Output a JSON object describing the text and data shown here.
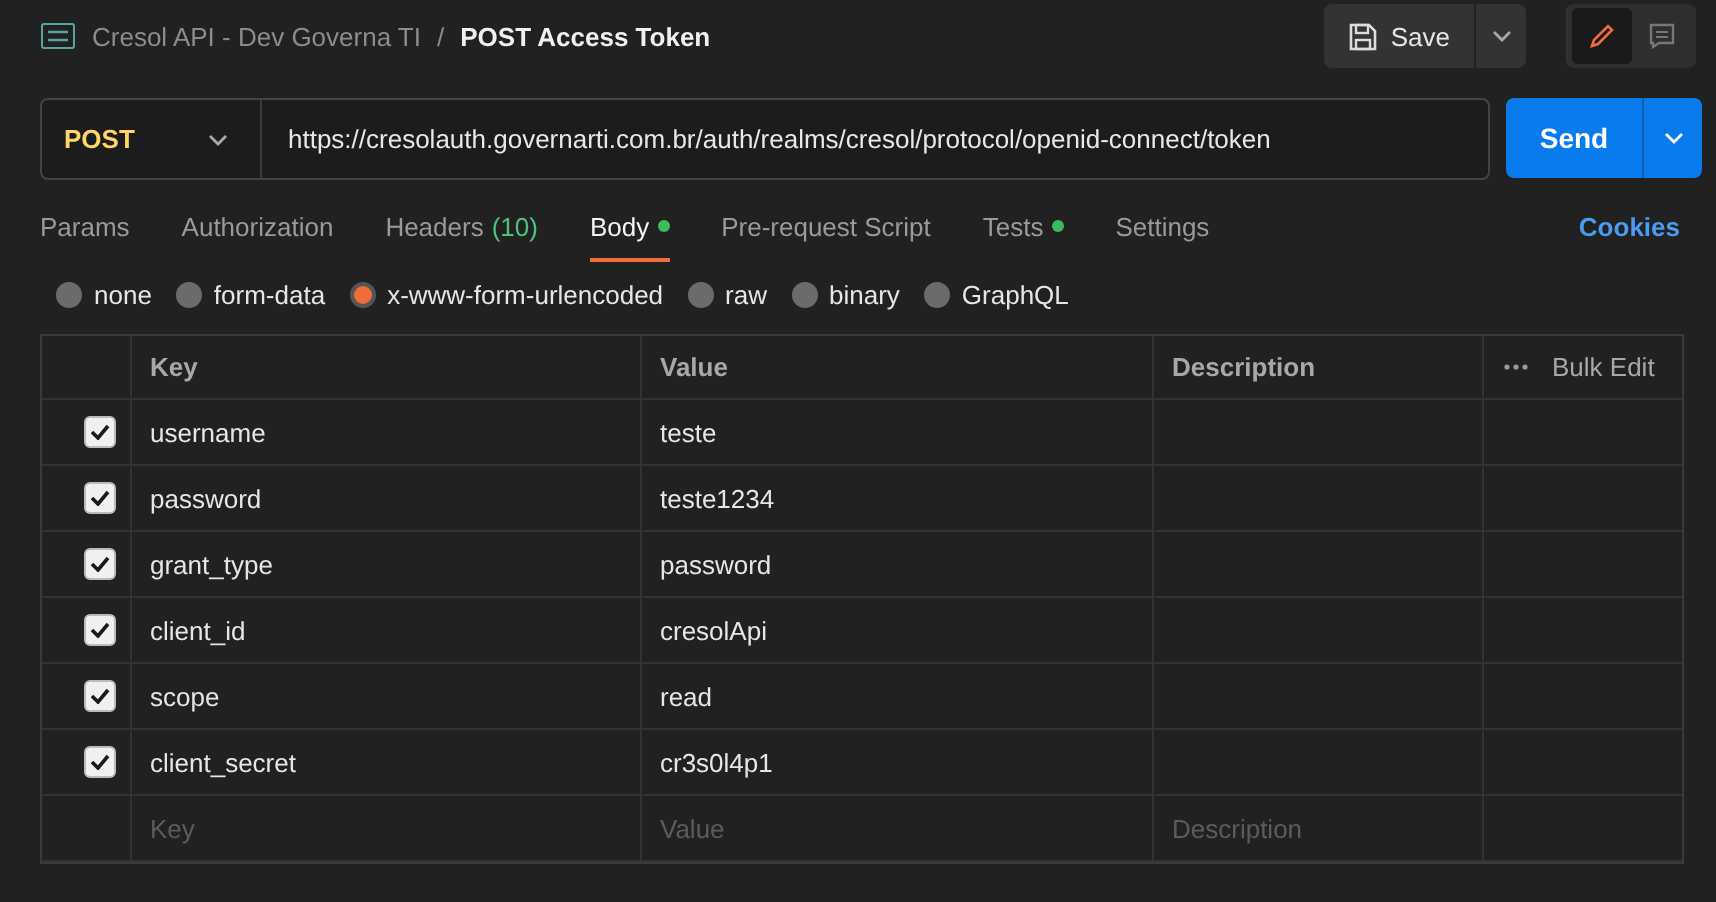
{
  "breadcrumb": {
    "collection": "Cresol API - Dev Governa TI",
    "separator": "/",
    "request": "POST Access Token"
  },
  "toolbar": {
    "save": "Save"
  },
  "request": {
    "method": "POST",
    "url": "https://cresolauth.governarti.com.br/auth/realms/cresol/protocol/openid-connect/token",
    "send": "Send"
  },
  "tabs": [
    {
      "label": "Params",
      "selected": false,
      "dot": false
    },
    {
      "label": "Authorization",
      "selected": false,
      "dot": false
    },
    {
      "label": "Headers",
      "count": "(10)",
      "selected": false,
      "dot": false
    },
    {
      "label": "Body",
      "selected": true,
      "dot": true
    },
    {
      "label": "Pre-request Script",
      "selected": false,
      "dot": false
    },
    {
      "label": "Tests",
      "selected": false,
      "dot": true
    },
    {
      "label": "Settings",
      "selected": false,
      "dot": false
    }
  ],
  "cookies": "Cookies",
  "body_types": [
    {
      "label": "none",
      "selected": false
    },
    {
      "label": "form-data",
      "selected": false
    },
    {
      "label": "x-www-form-urlencoded",
      "selected": true
    },
    {
      "label": "raw",
      "selected": false
    },
    {
      "label": "binary",
      "selected": false
    },
    {
      "label": "GraphQL",
      "selected": false
    }
  ],
  "table": {
    "columns": [
      "Key",
      "Value",
      "Description"
    ],
    "bulk_edit": "Bulk Edit",
    "rows": [
      {
        "checked": true,
        "key": "username",
        "value": "teste"
      },
      {
        "checked": true,
        "key": "password",
        "value": "teste1234"
      },
      {
        "checked": true,
        "key": "grant_type",
        "value": "password"
      },
      {
        "checked": true,
        "key": "client_id",
        "value": "cresolApi"
      },
      {
        "checked": true,
        "key": "scope",
        "value": "read"
      },
      {
        "checked": true,
        "key": "client_secret",
        "value": "cr3s0l4p1"
      }
    ],
    "placeholders": {
      "key": "Key",
      "value": "Value",
      "description": "Description"
    }
  }
}
